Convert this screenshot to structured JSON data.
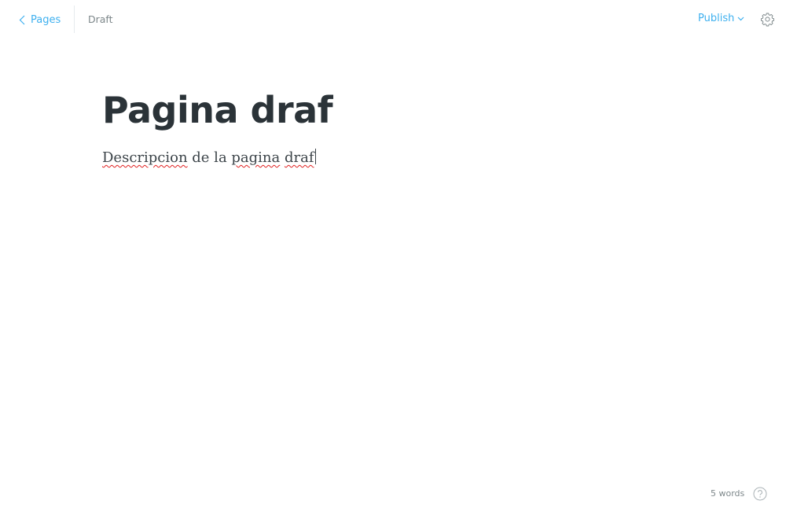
{
  "header": {
    "back_label": "Pages",
    "status": "Draft",
    "publish_label": "Publish"
  },
  "editor": {
    "title": "Pagina draf",
    "body_words": [
      "Descripcion",
      " de la ",
      "pagina",
      " ",
      "draf"
    ]
  },
  "footer": {
    "word_count": "5 words"
  },
  "colors": {
    "accent": "#3eb0ef",
    "title": "#2b3338",
    "muted": "#7d878a",
    "spellcheck": "#e02020"
  },
  "icons": {
    "back": "chevron-left-icon",
    "publish_dropdown": "chevron-down-icon",
    "settings": "gear-icon",
    "help": "question-circle-icon"
  }
}
